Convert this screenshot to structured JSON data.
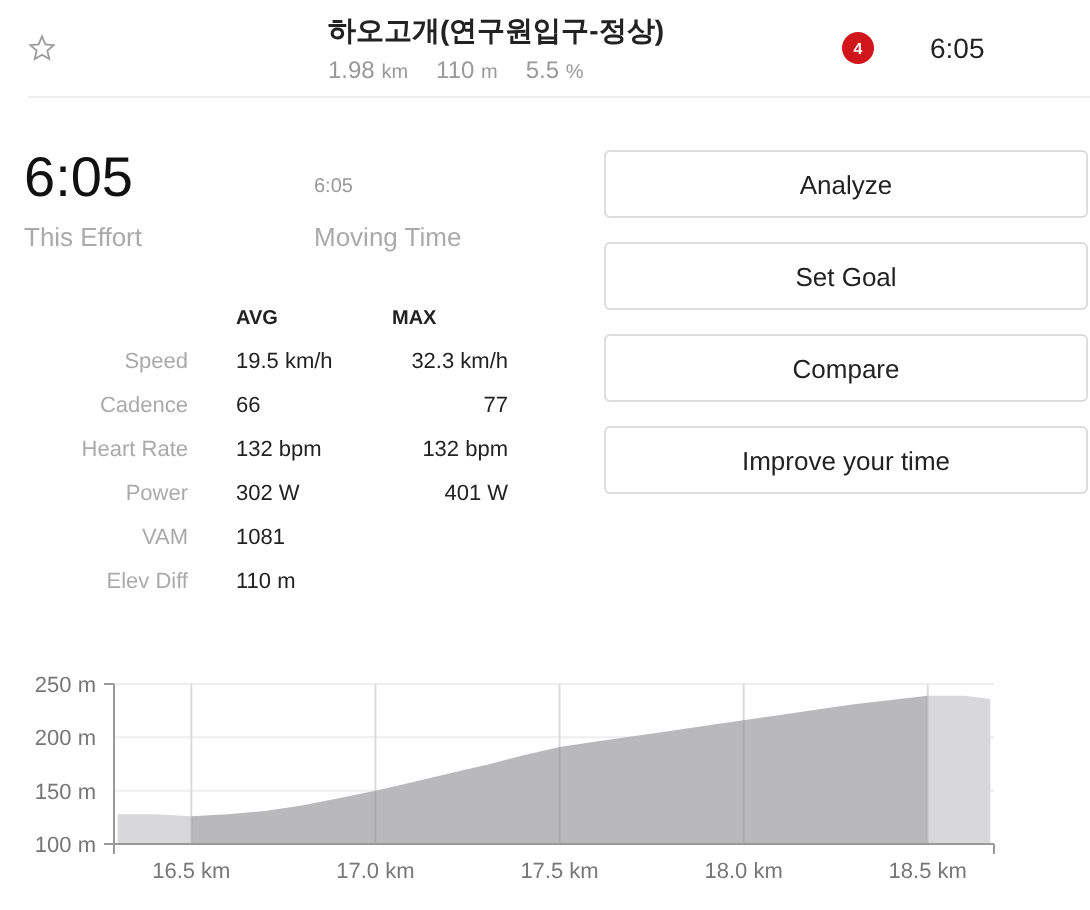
{
  "header": {
    "title": "하오고개(연구원입구-정상)",
    "starred": false,
    "stats": [
      {
        "value": "1.98",
        "unit": "km"
      },
      {
        "value": "110",
        "unit": "m"
      },
      {
        "value": "5.5",
        "unit": "%"
      }
    ],
    "badge": "4",
    "time": "6:05"
  },
  "effort": {
    "time": "6:05",
    "label": "This Effort",
    "moving_time": "6:05",
    "moving_label": "Moving Time"
  },
  "stats_table": {
    "columns": [
      "AVG",
      "MAX"
    ],
    "rows": [
      {
        "label": "Speed",
        "avg": "19.5 km/h",
        "max": "32.3 km/h"
      },
      {
        "label": "Cadence",
        "avg": "66",
        "max": "77"
      },
      {
        "label": "Heart Rate",
        "avg": "132 bpm",
        "max": "132 bpm"
      },
      {
        "label": "Power",
        "avg": "302 W",
        "max": "401 W"
      },
      {
        "label": "VAM",
        "avg": "1081"
      },
      {
        "label": "Elev Diff",
        "avg": "110 m"
      }
    ]
  },
  "buttons": [
    "Analyze",
    "Set Goal",
    "Compare",
    "Improve your time"
  ],
  "chart_data": {
    "type": "area",
    "x": [
      16.3,
      16.4,
      16.5,
      16.6,
      16.7,
      16.8,
      16.9,
      17.0,
      17.1,
      17.2,
      17.3,
      17.4,
      17.5,
      17.6,
      17.7,
      17.8,
      17.9,
      18.0,
      18.1,
      18.2,
      18.3,
      18.4,
      18.5,
      18.6,
      18.67
    ],
    "series": [
      {
        "color": "#b9b8ba",
        "values": [
          null,
          null,
          126,
          128,
          131,
          136,
          143,
          150,
          158,
          166,
          174,
          183,
          191,
          196,
          201,
          206,
          211,
          216,
          221,
          226,
          231,
          235,
          239,
          null,
          null
        ]
      },
      {
        "color": "#d8d7d9",
        "values": [
          128,
          128,
          126,
          null,
          null,
          null,
          null,
          null,
          null,
          null,
          null,
          null,
          null,
          null,
          null,
          null,
          null,
          null,
          null,
          null,
          null,
          null,
          239,
          239,
          236
        ]
      }
    ],
    "grid": true,
    "xlim": [
      16.29,
      18.68
    ],
    "ylim": [
      100,
      250
    ],
    "xticks": [
      {
        "value": 16.5,
        "label": "16.5 km"
      },
      {
        "value": 17.0,
        "label": "17.0 km"
      },
      {
        "value": 17.5,
        "label": "17.5 km"
      },
      {
        "value": 18.0,
        "label": "18.0 km"
      },
      {
        "value": 18.5,
        "label": "18.5 km"
      }
    ],
    "yticks": [
      {
        "value": 100,
        "label": "100 m"
      },
      {
        "value": 150,
        "label": "150 m"
      },
      {
        "value": 200,
        "label": "200 m"
      },
      {
        "value": 250,
        "label": "250 m"
      }
    ]
  }
}
